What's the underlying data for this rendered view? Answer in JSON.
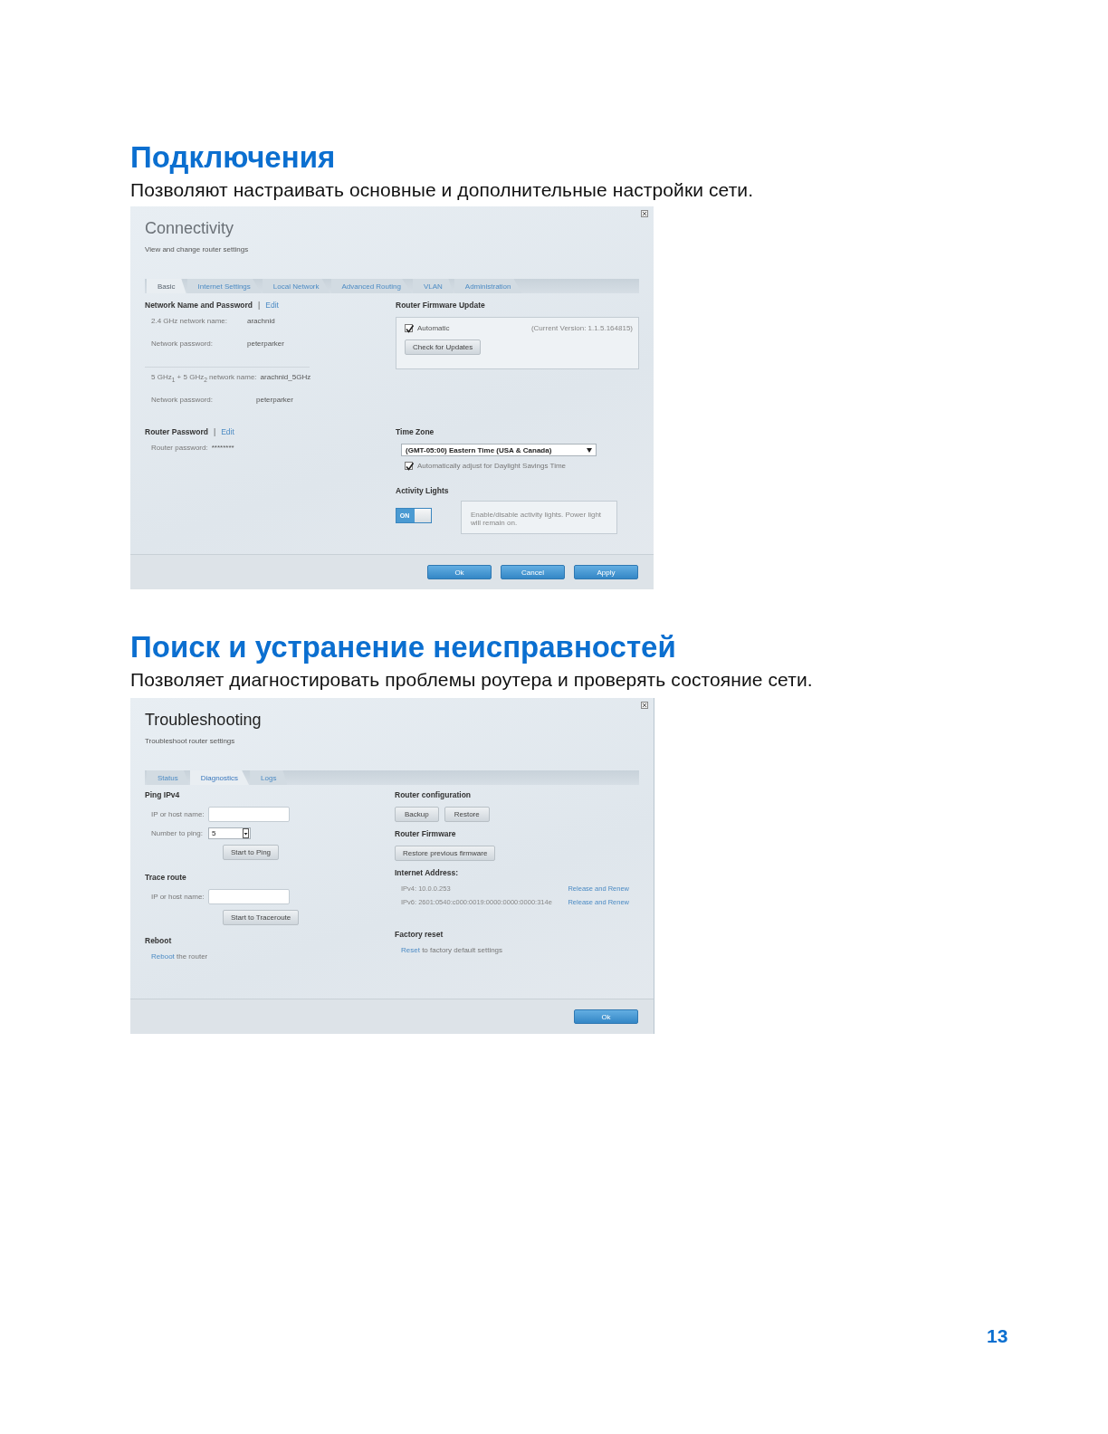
{
  "sections": [
    {
      "kind": "connectivity",
      "heading": "Подключения",
      "intro": "Позволяют настраивать основные и дополнительные настройки сети.",
      "panel": {
        "title": "Connectivity",
        "subtitle": "View and change router settings",
        "tabs": [
          {
            "label": "Basic",
            "selected": true
          },
          {
            "label": "Internet Settings",
            "selected": false
          },
          {
            "label": "Local Network",
            "selected": false
          },
          {
            "label": "Advanced Routing",
            "selected": false
          },
          {
            "label": "VLAN",
            "selected": false
          },
          {
            "label": "Administration",
            "selected": false
          }
        ],
        "network": {
          "heading": "Network Name and Password",
          "separator": "|",
          "edit": "Edit",
          "groups": [
            [
              {
                "label": "2.4 GHz network name:",
                "value": "arachnid"
              },
              {
                "label": "Network password:",
                "value": "peterparker"
              }
            ],
            [
              {
                "label": "5 GHz$_{1}$ + 5 GHz$_{2}$ network name:",
                "value": "arachnid_5GHz"
              },
              {
                "label": "Network password:",
                "value": "peterparker"
              }
            ]
          ]
        },
        "router_password": {
          "heading": "Router Password",
          "separator": "|",
          "edit": "Edit",
          "label": "Router password:",
          "value": "********"
        },
        "firmware": {
          "heading": "Router Firmware Update",
          "automatic": {
            "label": "Automatic",
            "checked": true
          },
          "version": "(Current Version: 1.1.5.164815)",
          "button": "Check for Updates"
        },
        "time_zone": {
          "heading": "Time Zone",
          "value": "(GMT-05:00) Eastern Time (USA & Canada)",
          "dst": {
            "label": "Automatically adjust for Daylight Savings Time",
            "checked": true
          }
        },
        "activity_lights": {
          "heading": "Activity Lights",
          "toggle": {
            "label": "ON",
            "on": true
          },
          "note": "Enable/disable activity lights. Power light will remain on."
        },
        "buttons": [
          {
            "label": "Ok"
          },
          {
            "label": "Cancel"
          },
          {
            "label": "Apply"
          }
        ]
      }
    },
    {
      "kind": "troubleshooting",
      "heading": "Поиск и устранение неисправностей",
      "intro": "Позволяет диагностировать проблемы роутера и проверять состояние сети.",
      "panel": {
        "title": "Troubleshooting",
        "subtitle": "Troubleshoot router settings",
        "tabs": [
          {
            "label": "Status",
            "selected": false
          },
          {
            "label": "Diagnostics",
            "selected": true
          },
          {
            "label": "Logs",
            "selected": false
          }
        ],
        "ping": {
          "heading": "Ping IPv4",
          "host_label": "IP or host name:",
          "count_label": "Number to ping:",
          "count_value": "5",
          "button": "Start to Ping"
        },
        "trace": {
          "heading": "Trace route",
          "host_label": "IP or host name:",
          "button": "Start to Traceroute"
        },
        "reboot": {
          "heading": "Reboot",
          "link": "Reboot",
          "text": " the router"
        },
        "configuration": {
          "heading": "Router configuration",
          "buttons": [
            "Backup",
            "Restore"
          ]
        },
        "firmware": {
          "heading": "Router Firmware",
          "button": "Restore previous firmware"
        },
        "internet": {
          "heading": "Internet Address:",
          "rows": [
            {
              "address": "IPv4: 10.0.0.253",
              "link": "Release and Renew"
            },
            {
              "address": "IPv6: 2601:0540:c000:0019:0000:0000:0000:314e",
              "link": "Release and Renew"
            }
          ]
        },
        "factory_reset": {
          "heading": "Factory reset",
          "link": "Reset",
          "text": " to factory default settings"
        },
        "buttons": [
          {
            "label": "Ok"
          }
        ]
      }
    }
  ],
  "page_number": "13"
}
